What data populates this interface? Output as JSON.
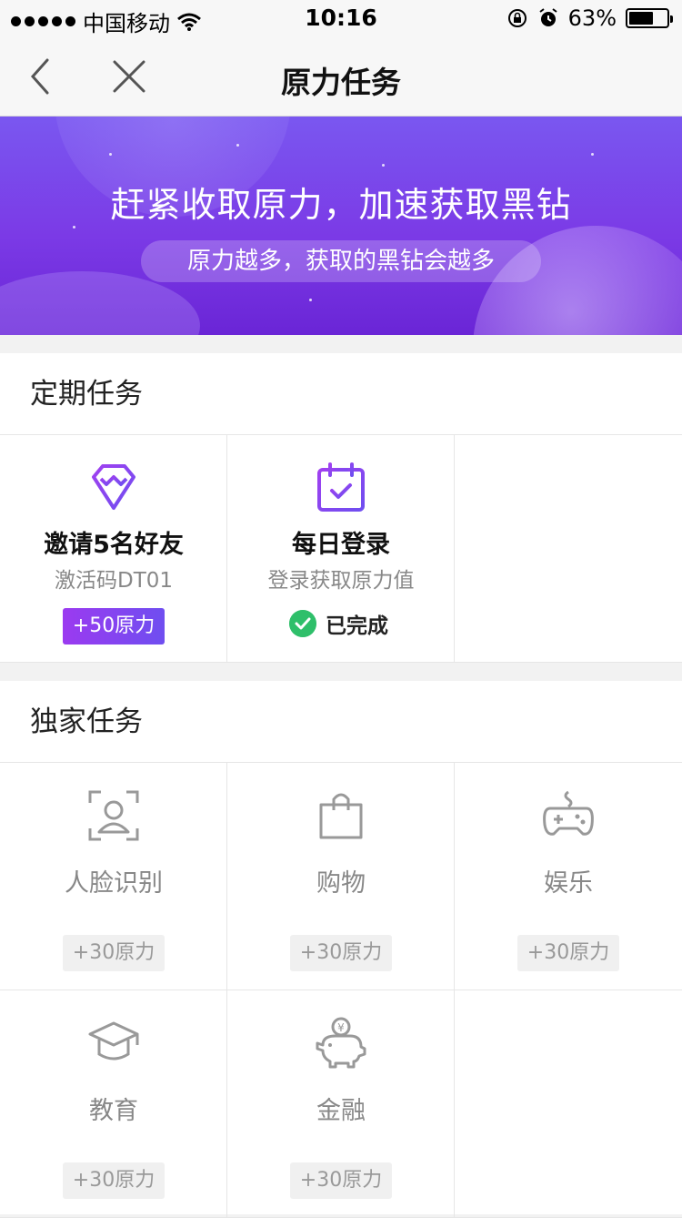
{
  "status_bar": {
    "carrier": "中国移动",
    "time": "10:16",
    "battery": "63%"
  },
  "nav": {
    "title": "原力任务"
  },
  "banner": {
    "headline": "赶紧收取原力，加速获取黑钻",
    "subtitle": "原力越多，获取的黑钻会越多"
  },
  "regular": {
    "title": "定期任务",
    "tasks": [
      {
        "name": "邀请5名好友",
        "sub": "激活码DT01",
        "reward": "+50原力"
      },
      {
        "name": "每日登录",
        "sub": "登录获取原力值",
        "status": "已完成"
      }
    ]
  },
  "exclusive": {
    "title": "独家任务",
    "tasks": [
      {
        "name": "人脸识别",
        "reward": "+30原力",
        "icon": "face-scan-icon"
      },
      {
        "name": "购物",
        "reward": "+30原力",
        "icon": "shopping-bag-icon"
      },
      {
        "name": "娱乐",
        "reward": "+30原力",
        "icon": "gamepad-icon"
      },
      {
        "name": "教育",
        "reward": "+30原力",
        "icon": "graduation-cap-icon"
      },
      {
        "name": "金融",
        "reward": "+30原力",
        "icon": "piggy-bank-icon"
      }
    ]
  },
  "colors": {
    "accent_purple": "#7b3ae6",
    "success_green": "#2fbf6a"
  }
}
